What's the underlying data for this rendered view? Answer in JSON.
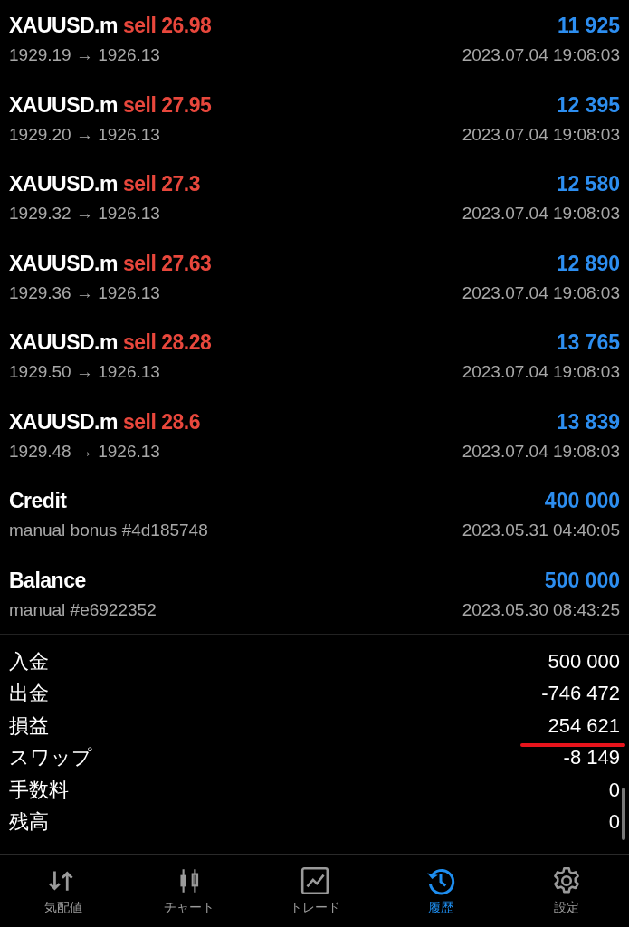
{
  "deals": [
    {
      "kind": "trade",
      "symbol": "XAUUSD.m",
      "action": "sell 26.98",
      "amount": "11 925",
      "detail": "1929.19 → 1926.13",
      "time": "2023.07.04 19:08:03"
    },
    {
      "kind": "trade",
      "symbol": "XAUUSD.m",
      "action": "sell 27.95",
      "amount": "12 395",
      "detail": "1929.20 → 1926.13",
      "time": "2023.07.04 19:08:03"
    },
    {
      "kind": "trade",
      "symbol": "XAUUSD.m",
      "action": "sell 27.3",
      "amount": "12 580",
      "detail": "1929.32 → 1926.13",
      "time": "2023.07.04 19:08:03"
    },
    {
      "kind": "trade",
      "symbol": "XAUUSD.m",
      "action": "sell 27.63",
      "amount": "12 890",
      "detail": "1929.36 → 1926.13",
      "time": "2023.07.04 19:08:03"
    },
    {
      "kind": "trade",
      "symbol": "XAUUSD.m",
      "action": "sell 28.28",
      "amount": "13 765",
      "detail": "1929.50 → 1926.13",
      "time": "2023.07.04 19:08:03"
    },
    {
      "kind": "trade",
      "symbol": "XAUUSD.m",
      "action": "sell 28.6",
      "amount": "13 839",
      "detail": "1929.48 → 1926.13",
      "time": "2023.07.04 19:08:03"
    },
    {
      "kind": "balance",
      "symbol": "Credit",
      "amount": "400 000",
      "detail": "manual bonus #4d185748",
      "time": "2023.05.31 04:40:05"
    },
    {
      "kind": "balance",
      "symbol": "Balance",
      "amount": "500 000",
      "detail": "manual #e6922352",
      "time": "2023.05.30 08:43:25"
    }
  ],
  "summary": [
    {
      "label": "入金",
      "value": "500 000",
      "underlined": false
    },
    {
      "label": "出金",
      "value": "-746 472",
      "underlined": false
    },
    {
      "label": "損益",
      "value": "254 621",
      "underlined": true
    },
    {
      "label": "スワップ",
      "value": "-8 149",
      "underlined": false
    },
    {
      "label": "手数料",
      "value": "0",
      "underlined": false
    },
    {
      "label": "残高",
      "value": "0",
      "underlined": false
    }
  ],
  "tabs": [
    {
      "kind": "quotes",
      "label": "気配値",
      "selected": false
    },
    {
      "kind": "chart",
      "label": "チャート",
      "selected": false
    },
    {
      "kind": "trade",
      "label": "トレード",
      "selected": false
    },
    {
      "kind": "history",
      "label": "履歴",
      "selected": true
    },
    {
      "kind": "settings",
      "label": "設定",
      "selected": false
    }
  ]
}
